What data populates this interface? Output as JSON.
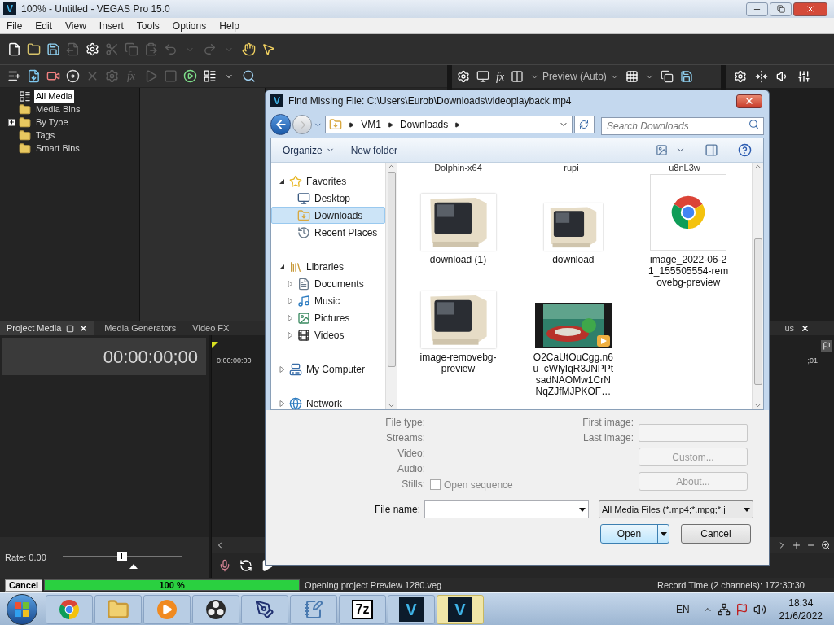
{
  "window": {
    "logo": "V",
    "title": "100% - Untitled - VEGAS Pro 15.0"
  },
  "menu": [
    "File",
    "Edit",
    "View",
    "Insert",
    "Tools",
    "Options",
    "Help"
  ],
  "main_toolbar": [
    {
      "disabled": false
    },
    {
      "disabled": false
    },
    {
      "disabled": false
    },
    {
      "disabled": true
    },
    {
      "disabled": false
    },
    {
      "disabled": true
    },
    {
      "disabled": true
    },
    {
      "disabled": true
    },
    {
      "disabled": true
    },
    {
      "disabled": true
    },
    {
      "disabled": true
    },
    {
      "disabled": true
    },
    {
      "disabled": false
    },
    {
      "disabled": false
    }
  ],
  "explorer_toolbar": [
    {
      "disabled": false
    },
    {
      "disabled": false
    },
    {
      "disabled": false
    },
    {
      "disabled": false
    },
    {
      "disabled": true
    },
    {
      "disabled": true
    },
    {
      "disabled": true,
      "label": "fx"
    },
    {
      "disabled": true
    },
    {
      "disabled": true
    },
    {
      "disabled": false
    },
    {
      "disabled": false
    },
    {
      "disabled": false
    },
    {
      "disabled": false
    }
  ],
  "media_tree": [
    {
      "label": "All Media",
      "kind": "root",
      "selected": true
    },
    {
      "label": "Media Bins",
      "kind": "folder",
      "selected": false
    },
    {
      "label": "By Type",
      "kind": "collapsed",
      "selected": false
    },
    {
      "label": "Tags",
      "kind": "folder",
      "selected": false
    },
    {
      "label": "Smart Bins",
      "kind": "folder",
      "selected": false
    }
  ],
  "preview_toolbar": {
    "fx": "fx",
    "mode": "Preview (Auto)"
  },
  "dock_tabs": [
    {
      "label": "Project Media",
      "selected": true
    },
    {
      "label": "Media Generators",
      "selected": false
    },
    {
      "label": "Video FX",
      "selected": false
    }
  ],
  "right_tab": {
    "label": "us"
  },
  "timecode": "00:00:00;00",
  "ruler": {
    "start": "0:00:00:00",
    "end": ";01"
  },
  "rate": {
    "label": "Rate: 0.00",
    "level": 0.5
  },
  "dialog": {
    "logo": "V",
    "title": "Find Missing File: C:\\Users\\Eurob\\Downloads\\videoplayback.mp4",
    "path": [
      "VM1",
      "Downloads"
    ],
    "search": {
      "placeholder": "Search Downloads"
    },
    "commands": [
      "Organize",
      "New folder"
    ],
    "nav": [
      {
        "label": "Favorites",
        "expanded": true,
        "selected": false,
        "children": [
          {
            "label": "Desktop",
            "selected": false
          },
          {
            "label": "Downloads",
            "selected": true
          },
          {
            "label": "Recent Places",
            "selected": false
          }
        ]
      },
      {
        "label": "Libraries",
        "expanded": true,
        "selected": false,
        "children": [
          {
            "label": "Documents",
            "expanded": false,
            "selected": false
          },
          {
            "label": "Music",
            "expanded": false,
            "selected": false
          },
          {
            "label": "Pictures",
            "expanded": false,
            "selected": false
          },
          {
            "label": "Videos",
            "expanded": false,
            "selected": false
          }
        ]
      },
      {
        "label": "My Computer",
        "expanded": false,
        "selected": false
      },
      {
        "label": "Network",
        "expanded": false,
        "selected": false
      }
    ],
    "files_cut": [
      "Dolphin-x64",
      "rupi",
      "u8nL3w"
    ],
    "files": [
      {
        "name": "download (1)",
        "kind": "monitor"
      },
      {
        "name": "download",
        "kind": "monitor-small"
      },
      {
        "name": "image_2022-06-21_155505554-removebg-preview",
        "kind": "chrome"
      },
      {
        "name": "image-removebg-preview",
        "kind": "monitor"
      },
      {
        "name": "O2CaUtOuCgg.n6u_cWlyIqR3JNPPtsadNAOMw1CrNNqZJfMJPKOF…",
        "kind": "video"
      }
    ],
    "info": {
      "labels": [
        "File type:",
        "Streams:",
        "Video:",
        "Audio:",
        "Stills:"
      ],
      "open_sequence": {
        "label": "Open sequence",
        "checked": false
      },
      "first_image": "First image:",
      "last_image": "Last image:",
      "buttons": [
        {
          "label": "Custom...",
          "disabled": true
        },
        {
          "label": "About...",
          "disabled": true
        }
      ]
    },
    "file_name": {
      "label": "File name:"
    },
    "filter": "All Media Files (*.mp4;*.mpg;*.j",
    "open": "Open",
    "cancel": "Cancel"
  },
  "status": {
    "cancel": "Cancel",
    "progress": {
      "level": 1,
      "label": "100 %"
    },
    "message": "Opening project Preview 1280.veg",
    "record_time": "Record Time (2 channels): 172:30:30"
  },
  "taskbar": {
    "apps": [
      {
        "kind": "chrome",
        "selected": false
      },
      {
        "kind": "folder",
        "selected": false
      },
      {
        "kind": "player",
        "selected": false
      },
      {
        "kind": "obs",
        "selected": false
      },
      {
        "kind": "paint",
        "selected": false
      },
      {
        "kind": "notepad",
        "selected": false
      },
      {
        "kind": "archiver",
        "label": "7z",
        "selected": false
      },
      {
        "kind": "vegas",
        "label": "V",
        "selected": false
      },
      {
        "kind": "vegas",
        "label": "V",
        "selected": true
      }
    ],
    "language": "EN",
    "time": "18:34",
    "date": "21/6/2022"
  }
}
